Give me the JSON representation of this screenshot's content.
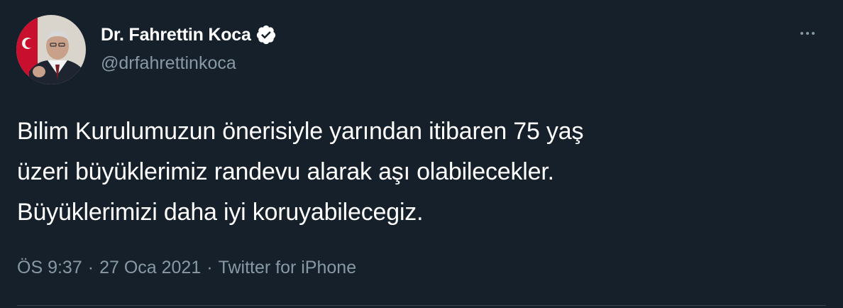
{
  "author": {
    "display_name": "Dr. Fahrettin Koca",
    "handle": "@drfahrettinkoca",
    "verified": true,
    "avatar_icon": "profile-photo"
  },
  "tweet": {
    "lines": [
      "Bilim Kurulumuzun önerisiyle yarından itibaren 75 yaş",
      "üzeri büyüklerimiz randevu alarak aşı olabilecekler.",
      "Büyüklerimizi daha iyi koruyabilecegiz."
    ]
  },
  "meta": {
    "time": "ÖS 9:37",
    "separator": "·",
    "date": "27 Oca 2021",
    "source": "Twitter for iPhone"
  },
  "menu": {
    "icon": "more-dots-icon"
  },
  "colors": {
    "background": "#15202b",
    "primary_text": "#ffffff",
    "secondary_text": "#8899a6",
    "verified_badge": "#ffffff",
    "divider": "#38444d"
  }
}
